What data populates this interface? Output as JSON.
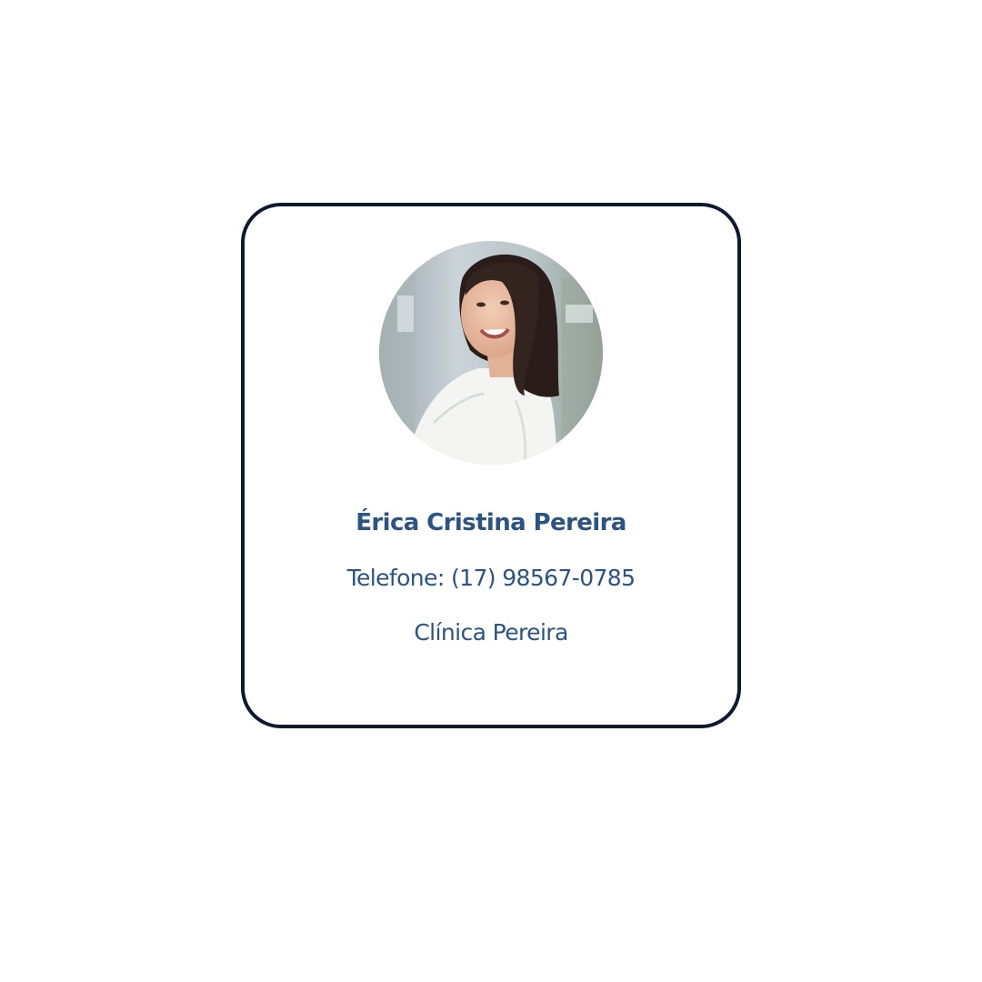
{
  "profile_card": {
    "avatar_icon": "profile-photo",
    "name": "Érica Cristina Pereira",
    "phone": "Telefone: (17) 98567-0785",
    "clinic": "Clínica Pereira"
  },
  "colors": {
    "border": "#0e1a30",
    "text": "#2b5384",
    "background": "#ffffff"
  }
}
